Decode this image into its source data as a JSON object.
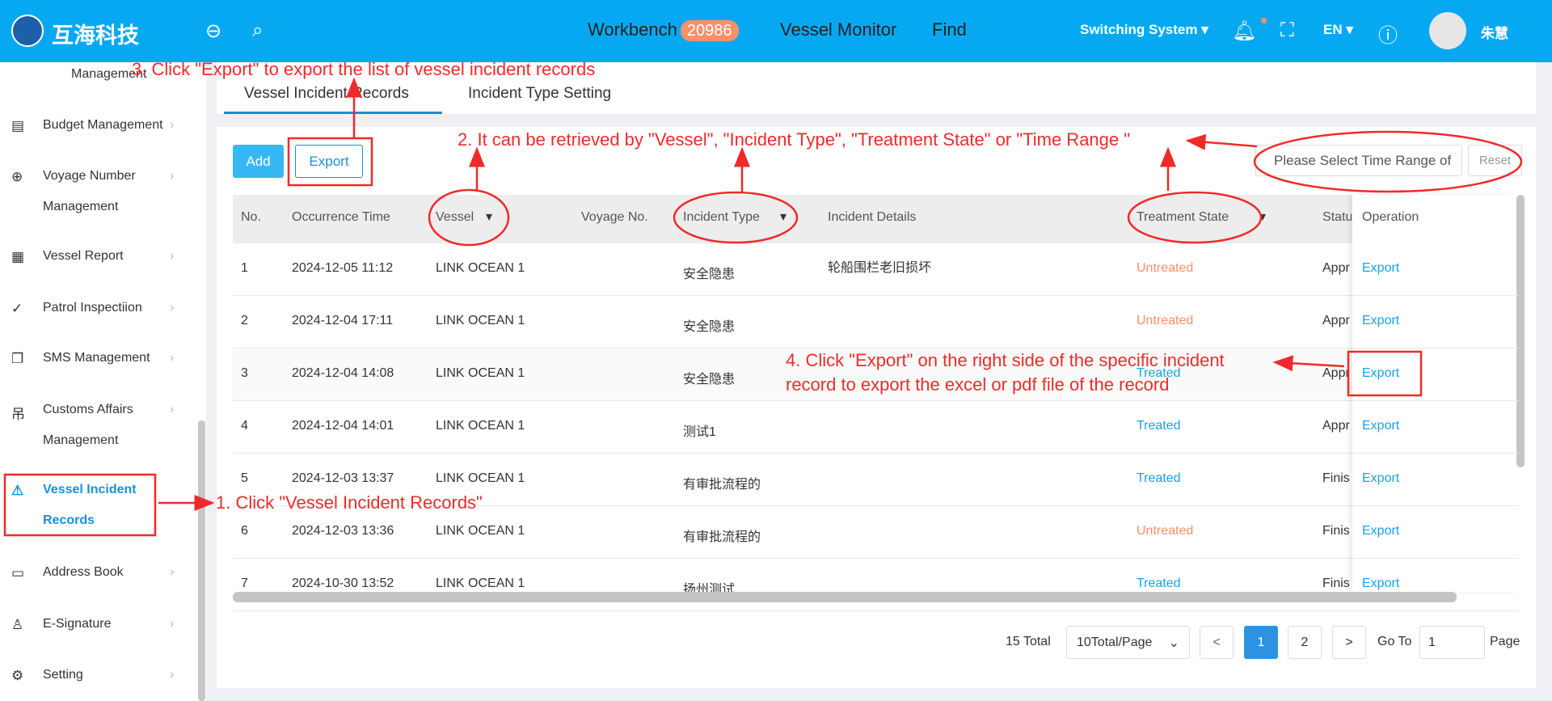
{
  "header": {
    "brand": "互海科技",
    "nav": [
      {
        "label": "Workbench",
        "badge": "20986"
      },
      {
        "label": "Vessel Monitor"
      },
      {
        "label": "Find"
      }
    ],
    "switching": "Switching System ▾",
    "lang": "EN ▾",
    "user": "朱慧"
  },
  "sidebar": {
    "items": [
      {
        "label": "Management",
        "icon": "none"
      },
      {
        "label": "Budget Management",
        "icon": "calculator-icon"
      },
      {
        "label": "Voyage Number",
        "label2": "Management",
        "icon": "globe-icon"
      },
      {
        "label": "Vessel Report",
        "icon": "calendar-icon"
      },
      {
        "label": "Patrol Inspectiion",
        "icon": "check-circle-icon"
      },
      {
        "label": "SMS Management",
        "icon": "document-icon"
      },
      {
        "label": "Customs Affairs",
        "label2": "Management",
        "icon": "customs-icon"
      },
      {
        "label": "Vessel Incident",
        "label2": "Records",
        "icon": "warning-icon",
        "active": true
      },
      {
        "label": "Address Book",
        "icon": "address-book-icon"
      },
      {
        "label": "E-Signature",
        "icon": "stamp-icon"
      },
      {
        "label": "Setting",
        "icon": "gear-icon"
      }
    ]
  },
  "tabs": [
    "Vessel Incident Records",
    "Incident Type Setting"
  ],
  "toolbar": {
    "add": "Add",
    "export": "Export",
    "time_placeholder": "Please Select Time Range of",
    "reset": "Reset"
  },
  "table": {
    "columns": [
      "No.",
      "Occurrence Time",
      "Vessel",
      "Voyage No.",
      "Incident Type",
      "Incident Details",
      "Treatment State",
      "Status",
      "Operation"
    ],
    "rows": [
      [
        "1",
        "2024-12-05 11:12",
        "LINK OCEAN 1",
        "",
        "安全隐患",
        "轮船围栏老旧损坏",
        "Untreated",
        "Appr",
        "Export"
      ],
      [
        "2",
        "2024-12-04 17:11",
        "LINK OCEAN 1",
        "",
        "安全隐患",
        "",
        "Untreated",
        "Appr",
        "Export"
      ],
      [
        "3",
        "2024-12-04 14:08",
        "LINK OCEAN 1",
        "",
        "安全隐患",
        "",
        "Treated",
        "Appr",
        "Export"
      ],
      [
        "4",
        "2024-12-04 14:01",
        "LINK OCEAN 1",
        "",
        "测试1",
        "",
        "Treated",
        "Appr",
        "Export"
      ],
      [
        "5",
        "2024-12-03 13:37",
        "LINK OCEAN 1",
        "",
        "有审批流程的",
        "",
        "Treated",
        "Finis",
        "Export"
      ],
      [
        "6",
        "2024-12-03 13:36",
        "LINK OCEAN 1",
        "",
        "有审批流程的",
        "",
        "Untreated",
        "Finis",
        "Export"
      ],
      [
        "7",
        "2024-10-30 13:52",
        "LINK OCEAN 1",
        "",
        "扬州测试",
        "",
        "Treated",
        "Finis",
        "Export"
      ]
    ]
  },
  "pagination": {
    "total": "15 Total",
    "page_size": "10Total/Page",
    "prev": "<",
    "pages": [
      "1",
      "2"
    ],
    "current": "1",
    "next": ">",
    "goto": "Go To",
    "goto_value": "1",
    "page": "Page"
  },
  "colors": {
    "header": "#06a9f1",
    "untreated": "#f8906a",
    "treated": "#1aa0e8",
    "annotation": "#f02a2a"
  },
  "annotations": {
    "a1": "1. Click \"Vessel Incident Records\"",
    "a2": "2. It can be retrieved by \"Vessel\", \"Incident Type\", \"Treatment State\" or \"Time Range \"",
    "a3": "3. Click \"Export\" to export the list of vessel incident records",
    "a4_line1": "4. Click \"Export\" on the right side of the specific incident",
    "a4_line2": "record to export the excel or pdf file of the record"
  }
}
